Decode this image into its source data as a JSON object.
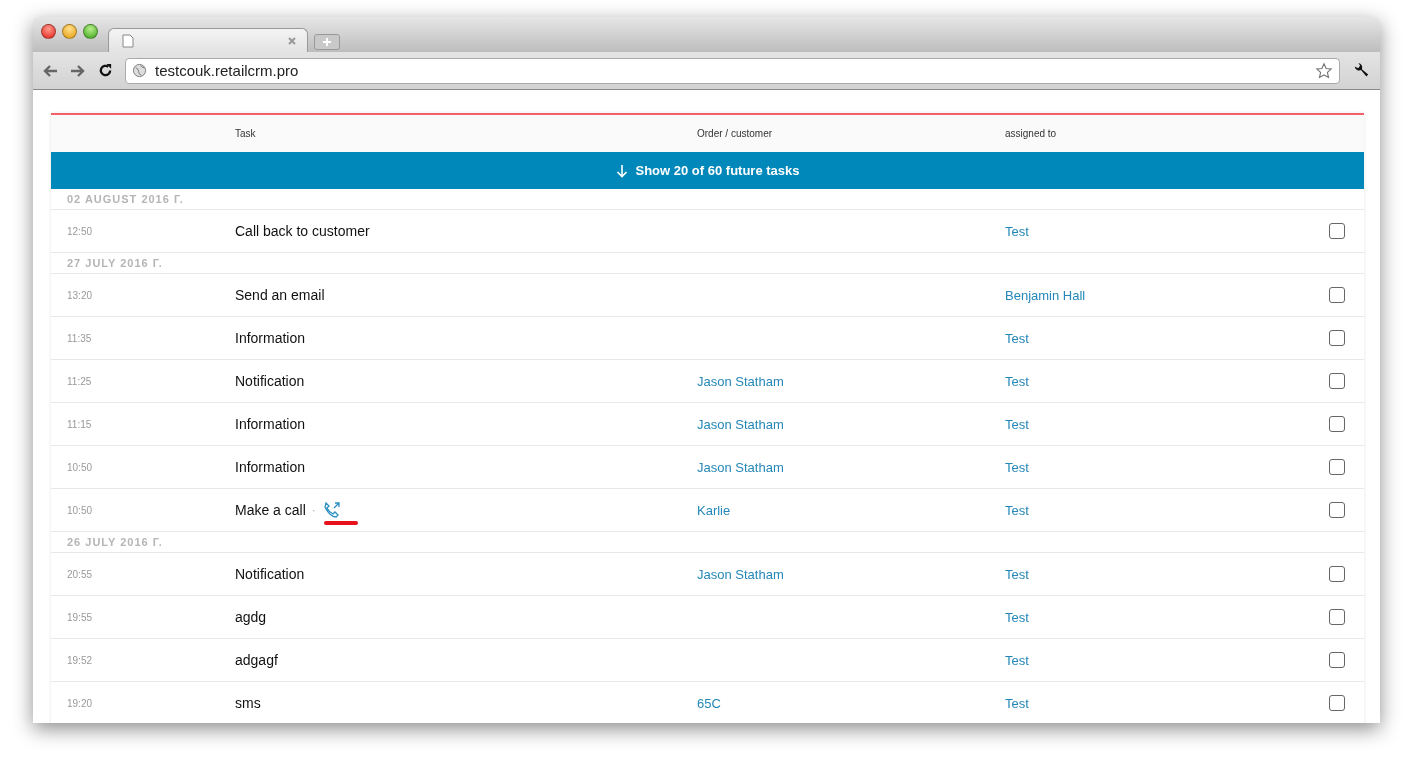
{
  "browser": {
    "url": "testcouk.retailcrm.pro"
  },
  "table": {
    "columns": [
      "Task",
      "Order / customer",
      "assigned to"
    ],
    "show_more": "Show 20 of 60 future tasks",
    "groups": [
      {
        "date": "02 AUGUST 2016 Г.",
        "tasks": [
          {
            "time": "12:50",
            "task": "Call back to customer",
            "assignee": "Test",
            "checked": false
          }
        ]
      },
      {
        "date": "27 JULY 2016 Г.",
        "tasks": [
          {
            "time": "13:20",
            "task": "Send an email",
            "assignee": "Benjamin Hall",
            "checked": false
          },
          {
            "time": "11:35",
            "task": "Information",
            "assignee": "Test",
            "checked": false
          },
          {
            "time": "11:25",
            "task": "Notification",
            "customer": "Jason Statham",
            "assignee": "Test",
            "checked": false
          },
          {
            "time": "11:15",
            "task": "Information",
            "customer": "Jason Statham",
            "assignee": "Test",
            "checked": false
          },
          {
            "time": "10:50",
            "task": "Information",
            "customer": "Jason Statham",
            "assignee": "Test",
            "checked": false
          },
          {
            "time": "10:50",
            "task": "Make a call",
            "call_link": {
              "separator": "·"
            },
            "customer": "Karlie",
            "assignee": "Test",
            "checked": false
          }
        ]
      },
      {
        "date": "26 JULY 2016 Г.",
        "tasks": [
          {
            "time": "20:55",
            "task": "Notification",
            "customer": "Jason Statham",
            "assignee": "Test",
            "checked": false
          },
          {
            "time": "19:55",
            "task": "agdg",
            "assignee": "Test",
            "checked": false
          },
          {
            "time": "19:52",
            "task": "adgagf",
            "assignee": "Test",
            "checked": false
          },
          {
            "time": "19:20",
            "task": "sms",
            "customer": "65C",
            "assignee": "Test",
            "checked": false
          }
        ]
      }
    ]
  }
}
